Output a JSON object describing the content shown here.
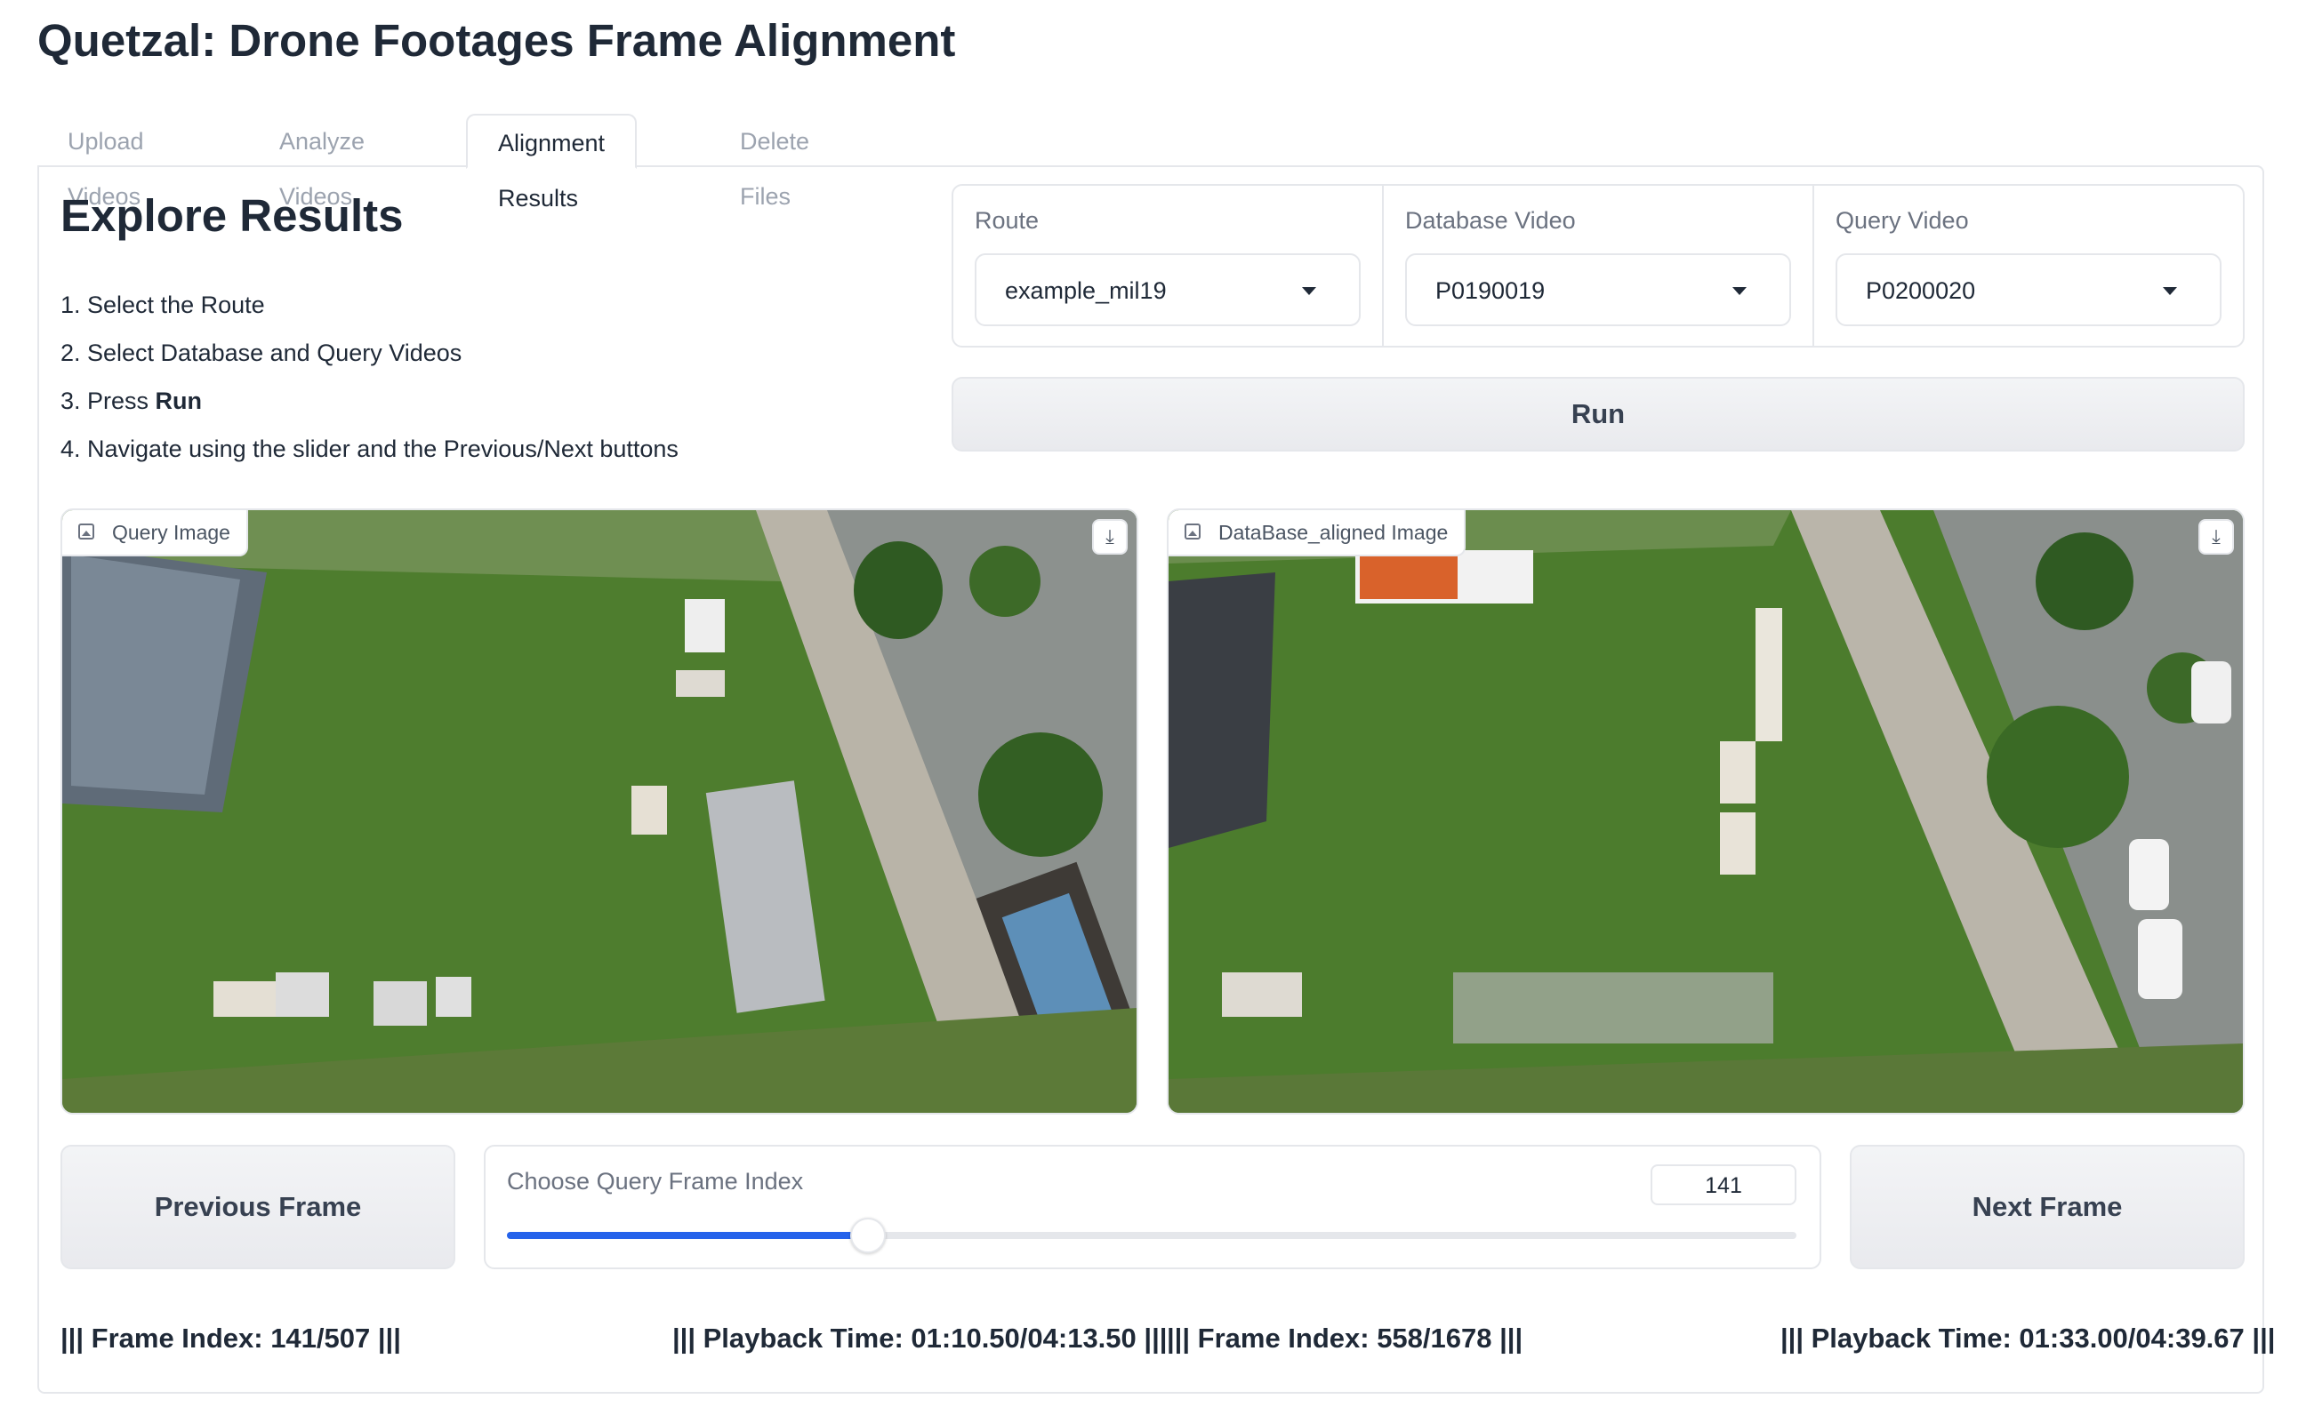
{
  "app": {
    "title": "Quetzal: Drone Footages Frame Alignment"
  },
  "tabs": [
    {
      "label": "Upload Videos"
    },
    {
      "label": "Analyze Videos"
    },
    {
      "label": "Alignment Results"
    },
    {
      "label": "Delete Files"
    }
  ],
  "active_tab": "Alignment Results",
  "explore": {
    "heading": "Explore Results",
    "steps": {
      "s1": "1. Select the Route",
      "s2": "2. Select Database and Query Videos",
      "s3_prefix": "3. Press ",
      "s3_bold": "Run",
      "s4": "4. Navigate using the slider and the Previous/Next buttons"
    }
  },
  "dropdowns": {
    "route": {
      "label": "Route",
      "value": "example_mil19"
    },
    "database": {
      "label": "Database Video",
      "value": "P0190019"
    },
    "query": {
      "label": "Query Video",
      "value": "P0200020"
    }
  },
  "run_label": "Run",
  "images": {
    "query": {
      "label": "Query Image"
    },
    "database": {
      "label": "DataBase_aligned Image"
    },
    "download_icon": "download-icon",
    "image_icon": "image-icon"
  },
  "controls": {
    "previous_label": "Previous Frame",
    "next_label": "Next Frame",
    "slider_label": "Choose Query Frame Index",
    "slider_value": "141",
    "slider_fraction": 0.28
  },
  "info": {
    "query_frame": "||| Frame Index: 141/507 |||",
    "query_time": "||| Playback Time: 01:10.50/04:13.50 |||",
    "db_frame": "||| Frame Index: 558/1678 |||",
    "db_time": "||| Playback Time: 01:33.00/04:39.67 |||"
  },
  "colors": {
    "accent": "#2563eb",
    "border": "#e5e7eb",
    "grass": "#4a7a2c"
  }
}
